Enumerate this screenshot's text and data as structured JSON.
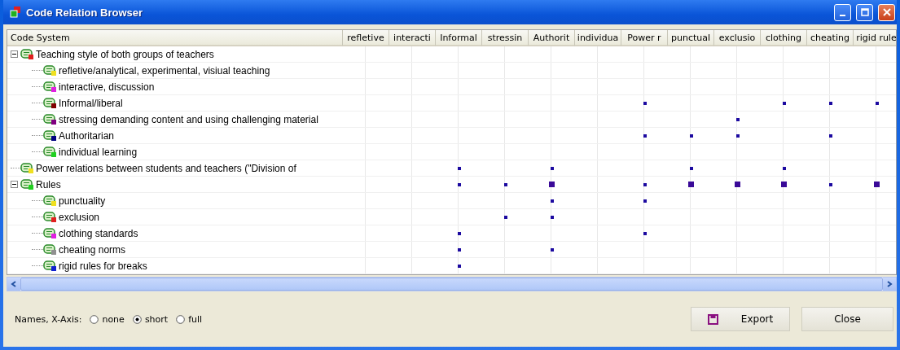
{
  "window": {
    "title": "Code Relation Browser"
  },
  "table": {
    "first_column": "Code System",
    "columns": [
      "refletive",
      "interacti",
      "Informal",
      "stressin",
      "Authorit",
      "individua",
      "Power r",
      "punctual",
      "exclusio",
      "clothing",
      "cheating",
      "rigid rule"
    ],
    "tree": [
      {
        "label": "Teaching style of both groups of teachers",
        "color": "#e02020",
        "expanded": true,
        "cells": [
          {
            "linked": false
          },
          {
            "linked": false
          },
          {
            "linked": false
          },
          {
            "linked": false
          },
          {
            "linked": false
          },
          {
            "linked": false
          },
          {
            "linked": false
          },
          {
            "linked": false
          },
          {
            "linked": false
          },
          {
            "linked": false
          },
          {
            "linked": false
          },
          {
            "linked": false
          }
        ],
        "children": [
          {
            "label": "refletive/analytical, experimental, visiual teaching",
            "color": "#f0e020",
            "cells": [
              {
                "linked": false
              },
              {
                "linked": false
              },
              {
                "linked": false
              },
              {
                "linked": false
              },
              {
                "linked": false
              },
              {
                "linked": false
              },
              {
                "linked": false
              },
              {
                "linked": false
              },
              {
                "linked": false
              },
              {
                "linked": false
              },
              {
                "linked": false
              },
              {
                "linked": false
              }
            ]
          },
          {
            "label": "interactive, discussion",
            "color": "#e020e0",
            "cells": [
              {
                "linked": false
              },
              {
                "linked": false
              },
              {
                "linked": false
              },
              {
                "linked": false
              },
              {
                "linked": false
              },
              {
                "linked": false
              },
              {
                "linked": false
              },
              {
                "linked": false
              },
              {
                "linked": false
              },
              {
                "linked": false
              },
              {
                "linked": false
              },
              {
                "linked": false
              }
            ]
          },
          {
            "label": "Informal/liberal",
            "color": "#800000",
            "cells": [
              {
                "linked": false
              },
              {
                "linked": false
              },
              {
                "linked": false
              },
              {
                "linked": false
              },
              {
                "linked": false
              },
              {
                "linked": false
              },
              {
                "linked": true,
                "large": false
              },
              {
                "linked": false
              },
              {
                "linked": false
              },
              {
                "linked": true,
                "large": false
              },
              {
                "linked": true,
                "large": false
              },
              {
                "linked": true,
                "large": false
              }
            ]
          },
          {
            "label": "stressing demanding content and using challenging material",
            "color": "#800080",
            "cells": [
              {
                "linked": false
              },
              {
                "linked": false
              },
              {
                "linked": false
              },
              {
                "linked": false
              },
              {
                "linked": false
              },
              {
                "linked": false
              },
              {
                "linked": false
              },
              {
                "linked": false
              },
              {
                "linked": true,
                "large": false
              },
              {
                "linked": false
              },
              {
                "linked": false
              },
              {
                "linked": false
              }
            ]
          },
          {
            "label": "Authoritarian",
            "color": "#000080",
            "cells": [
              {
                "linked": false
              },
              {
                "linked": false
              },
              {
                "linked": false
              },
              {
                "linked": false
              },
              {
                "linked": false
              },
              {
                "linked": false
              },
              {
                "linked": true,
                "large": false
              },
              {
                "linked": true,
                "large": false
              },
              {
                "linked": true,
                "large": false
              },
              {
                "linked": false
              },
              {
                "linked": true,
                "large": false
              },
              {
                "linked": false
              }
            ]
          },
          {
            "label": "individual learning",
            "color": "#20d020",
            "cells": [
              {
                "linked": false
              },
              {
                "linked": false
              },
              {
                "linked": false
              },
              {
                "linked": false
              },
              {
                "linked": false
              },
              {
                "linked": false
              },
              {
                "linked": false
              },
              {
                "linked": false
              },
              {
                "linked": false
              },
              {
                "linked": false
              },
              {
                "linked": false
              },
              {
                "linked": false
              }
            ]
          }
        ]
      },
      {
        "label": "Power relations between students and teachers (\"Division of",
        "color": "#f0e020",
        "cells": [
          {
            "linked": false
          },
          {
            "linked": false
          },
          {
            "linked": true,
            "large": false
          },
          {
            "linked": false
          },
          {
            "linked": true,
            "large": false
          },
          {
            "linked": false
          },
          {
            "linked": false
          },
          {
            "linked": true,
            "large": false
          },
          {
            "linked": false
          },
          {
            "linked": true,
            "large": false
          },
          {
            "linked": false
          },
          {
            "linked": false
          }
        ]
      },
      {
        "label": "Rules",
        "color": "#20d020",
        "expanded": true,
        "cells": [
          {
            "linked": false
          },
          {
            "linked": false
          },
          {
            "linked": true,
            "large": false
          },
          {
            "linked": true,
            "large": false
          },
          {
            "linked": true,
            "large": true
          },
          {
            "linked": false
          },
          {
            "linked": true,
            "large": false
          },
          {
            "linked": true,
            "large": true
          },
          {
            "linked": true,
            "large": true
          },
          {
            "linked": true,
            "large": true
          },
          {
            "linked": true,
            "large": false
          },
          {
            "linked": true,
            "large": true
          }
        ],
        "children": [
          {
            "label": "punctuality",
            "color": "#f0e020",
            "cells": [
              {
                "linked": false
              },
              {
                "linked": false
              },
              {
                "linked": false
              },
              {
                "linked": false
              },
              {
                "linked": true,
                "large": false
              },
              {
                "linked": false
              },
              {
                "linked": true,
                "large": false
              },
              {
                "linked": false
              },
              {
                "linked": false
              },
              {
                "linked": false
              },
              {
                "linked": false
              },
              {
                "linked": false
              }
            ]
          },
          {
            "label": "exclusion",
            "color": "#e02020",
            "cells": [
              {
                "linked": false
              },
              {
                "linked": false
              },
              {
                "linked": false
              },
              {
                "linked": true,
                "large": false
              },
              {
                "linked": true,
                "large": false
              },
              {
                "linked": false
              },
              {
                "linked": false
              },
              {
                "linked": false
              },
              {
                "linked": false
              },
              {
                "linked": false
              },
              {
                "linked": false
              },
              {
                "linked": false
              }
            ]
          },
          {
            "label": "clothing standards",
            "color": "#e020e0",
            "cells": [
              {
                "linked": false
              },
              {
                "linked": false
              },
              {
                "linked": true,
                "large": false
              },
              {
                "linked": false
              },
              {
                "linked": false
              },
              {
                "linked": false
              },
              {
                "linked": true,
                "large": false
              },
              {
                "linked": false
              },
              {
                "linked": false
              },
              {
                "linked": false
              },
              {
                "linked": false
              },
              {
                "linked": false
              }
            ]
          },
          {
            "label": "cheating norms",
            "color": "#909090",
            "cells": [
              {
                "linked": false
              },
              {
                "linked": false
              },
              {
                "linked": true,
                "large": false
              },
              {
                "linked": false
              },
              {
                "linked": true,
                "large": false
              },
              {
                "linked": false
              },
              {
                "linked": false
              },
              {
                "linked": false
              },
              {
                "linked": false
              },
              {
                "linked": false
              },
              {
                "linked": false
              },
              {
                "linked": false
              }
            ]
          },
          {
            "label": "rigid rules for breaks",
            "color": "#1020d0",
            "cells": [
              {
                "linked": false
              },
              {
                "linked": false
              },
              {
                "linked": true,
                "large": false
              },
              {
                "linked": false
              },
              {
                "linked": false
              },
              {
                "linked": false
              },
              {
                "linked": false
              },
              {
                "linked": false
              },
              {
                "linked": false
              },
              {
                "linked": false
              },
              {
                "linked": false
              },
              {
                "linked": false
              }
            ]
          }
        ]
      }
    ]
  },
  "names_x_axis": {
    "label": "Names, X-Axis:",
    "options": [
      {
        "label": "none",
        "selected": false
      },
      {
        "label": "short",
        "selected": true
      },
      {
        "label": "full",
        "selected": false
      }
    ]
  },
  "buttons": [
    {
      "label": "Export",
      "kind": "export"
    },
    {
      "label": "Close",
      "kind": "plain"
    }
  ]
}
